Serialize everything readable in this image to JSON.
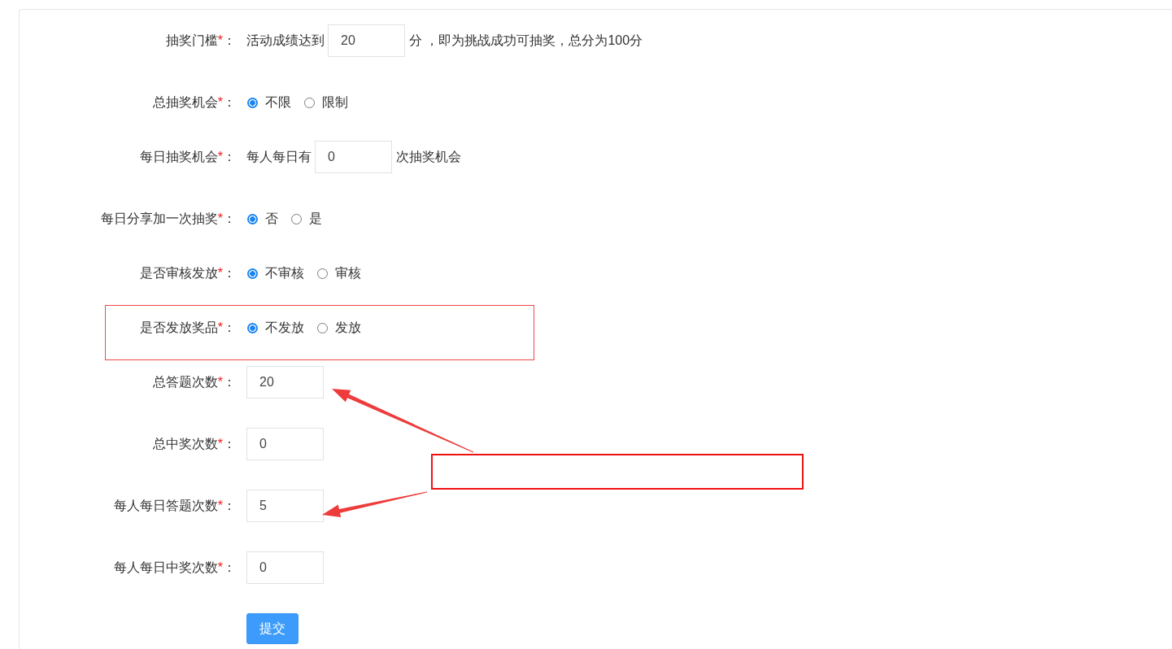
{
  "form": {
    "fields": [
      {
        "kind": "inline-input",
        "label": "抽奖门槛",
        "asterisk": "*",
        "colon": "：",
        "highlighted": false,
        "prefix": "活动成绩达到",
        "value": "20",
        "suffix": "分 ，即为挑战成功可抽奖，总分为100分"
      },
      {
        "kind": "radio",
        "label": "总抽奖机会",
        "asterisk": "*",
        "colon": "：",
        "highlighted": false,
        "options": [
          {
            "label": "不限",
            "selected": true
          },
          {
            "label": "限制",
            "selected": false
          }
        ]
      },
      {
        "kind": "inline-input",
        "label": "每日抽奖机会",
        "asterisk": "*",
        "colon": "：",
        "highlighted": false,
        "prefix": "每人每日有",
        "value": "0",
        "suffix": "次抽奖机会"
      },
      {
        "kind": "radio",
        "label": "每日分享加一次抽奖",
        "asterisk": "*",
        "colon": "：",
        "highlighted": false,
        "options": [
          {
            "label": "否",
            "selected": true
          },
          {
            "label": "是",
            "selected": false
          }
        ]
      },
      {
        "kind": "radio",
        "label": "是否审核发放",
        "asterisk": "*",
        "colon": "：",
        "highlighted": false,
        "options": [
          {
            "label": "不审核",
            "selected": true
          },
          {
            "label": "审核",
            "selected": false
          }
        ]
      },
      {
        "kind": "radio",
        "label": "是否发放奖品",
        "asterisk": "*",
        "colon": "：",
        "highlighted": true,
        "options": [
          {
            "label": "不发放",
            "selected": true
          },
          {
            "label": "发放",
            "selected": false
          }
        ]
      },
      {
        "kind": "input",
        "label": "总答题次数",
        "asterisk": "*",
        "colon": "：",
        "highlighted": false,
        "value": "20"
      },
      {
        "kind": "input",
        "label": "总中奖次数",
        "asterisk": "*",
        "colon": "：",
        "highlighted": false,
        "value": "0"
      },
      {
        "kind": "input",
        "label": "每人每日答题次数",
        "asterisk": "*",
        "colon": "：",
        "highlighted": false,
        "value": "5"
      },
      {
        "kind": "input",
        "label": "每人每日中奖次数",
        "asterisk": "*",
        "colon": "：",
        "highlighted": false,
        "value": "0"
      }
    ],
    "submit_button": "提交"
  }
}
